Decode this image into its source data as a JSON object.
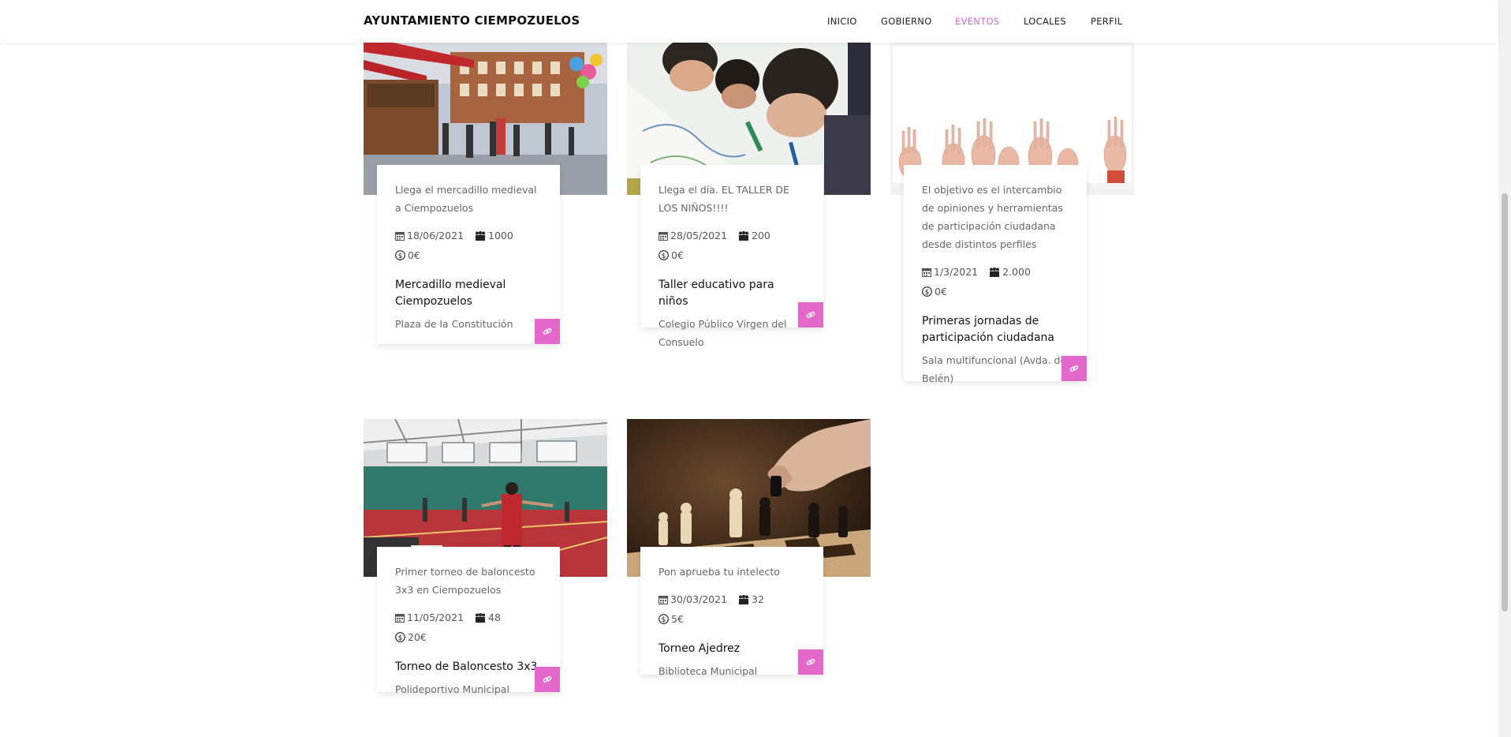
{
  "nav": {
    "brand": "AYUNTAMIENTO CIEMPOZUELOS",
    "items": [
      {
        "label": "INICIO"
      },
      {
        "label": "GOBIERNO"
      },
      {
        "label": "EVENTOS"
      },
      {
        "label": "LOCALES"
      },
      {
        "label": "PERFIL"
      }
    ],
    "active": "EVENTOS"
  },
  "colors": {
    "accent": "#e468c9",
    "nav_active": "#d86bc3"
  },
  "events": [
    {
      "description": "Llega el mercadillo medieval a Ciempozuelos",
      "date": "18/06/2021",
      "capacity": "1000",
      "price": "0€",
      "title": "Mercadillo medieval Ciempozuelos",
      "place": "Plaza de la Constitución",
      "image": "medieval-market-photo"
    },
    {
      "description": "Llega el día. EL TALLER DE LOS NIÑOS!!!!",
      "date": "28/05/2021",
      "capacity": "200",
      "price": "0€",
      "title": "Taller educativo para niños",
      "place": "Colegio Público Virgen del Consuelo",
      "image": "children-drawing-photo"
    },
    {
      "description": "El objetivo es el intercambio de opiniones y herramientas de participación ciudadana desde distintos perfiles",
      "date": "1/3/2021",
      "capacity": "2.000",
      "price": "0€",
      "title": "Primeras jornadas de participación ciudadana",
      "place": "Sala multifuncional (Avda. de Belén)",
      "image": "raised-hands-photo"
    },
    {
      "description": "Primer torneo de baloncesto 3x3 en Ciempozuelos",
      "date": "11/05/2021",
      "capacity": "48",
      "price": "20€",
      "title": "Torneo de Baloncesto 3x3",
      "place": "Polideportivo Municipal",
      "image": "sports-hall-photo"
    },
    {
      "description": "Pon aprueba tu intelecto",
      "date": "30/03/2021",
      "capacity": "32",
      "price": "5€",
      "title": "Torneo Ajedrez",
      "place": "Biblioteca Municipal",
      "image": "chess-photo"
    }
  ]
}
